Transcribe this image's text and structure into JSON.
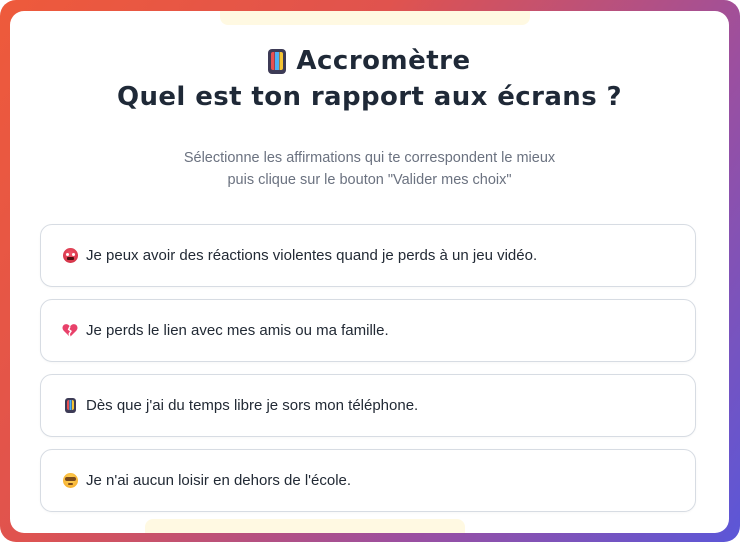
{
  "header": {
    "icon": "mobile-phone-icon",
    "title": "Accromètre",
    "question": "Quel est ton rapport aux écrans ?"
  },
  "instructions": {
    "line1": "Sélectionne les affirmations qui te correspondent le mieux",
    "line2": "puis clique sur le bouton \"Valider mes choix\""
  },
  "options": [
    {
      "icon": "angry-face-icon",
      "text": "Je peux avoir des réactions violentes quand je perds à un jeu vidéo."
    },
    {
      "icon": "broken-heart-icon",
      "text": "Je perds le lien avec mes amis ou ma famille."
    },
    {
      "icon": "mobile-phone-icon",
      "text": "Dès que j'ai du temps libre je sors mon téléphone."
    },
    {
      "icon": "face-with-glasses-icon",
      "text": "Je n'ai aucun loisir en dehors de l'école."
    }
  ],
  "colors": {
    "frame_gradient_start": "#ee5a3b",
    "frame_gradient_end": "#5b57d8",
    "title": "#1f2937",
    "muted_text": "#6b7280",
    "option_border": "#d7dce3"
  }
}
